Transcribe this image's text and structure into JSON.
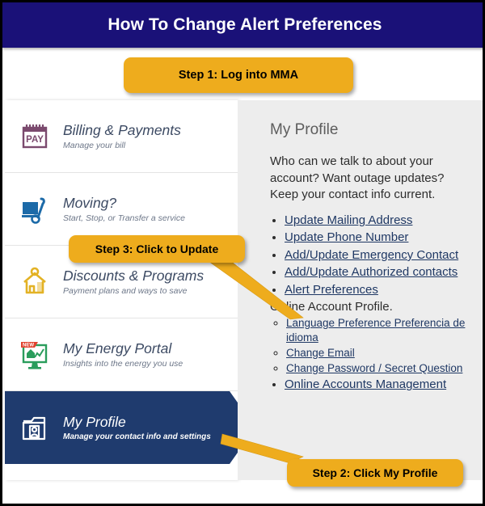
{
  "header": {
    "title": "How To Change Alert Preferences",
    "bg_color": "#1a1178",
    "text_color": "#ffffff"
  },
  "callouts": {
    "accent_color": "#eeac1d",
    "step1": "Step 1:  Log into MMA",
    "step3": "Step 3: Click to Update",
    "step2": "Step 2: Click My Profile"
  },
  "sidebar": {
    "items": [
      {
        "title": "Billing & Payments",
        "subtitle": "Manage your bill",
        "icon": "pay-calendar-icon",
        "icon_color": "#7b4a6e",
        "active": false
      },
      {
        "title": "Moving?",
        "subtitle": "Start, Stop, or Transfer a service",
        "icon": "hand-truck-icon",
        "icon_color": "#1c6aa8",
        "active": false
      },
      {
        "title": "Discounts & Programs",
        "subtitle": "Payment plans and ways to save",
        "icon": "house-icon",
        "icon_color": "#e3b225",
        "active": false
      },
      {
        "title": "My Energy Portal",
        "subtitle": "Insights into the energy you use",
        "icon": "monitor-chart-new-icon",
        "icon_color": "#2a9d5c",
        "badge": "NEW",
        "badge_color": "#e1412c",
        "active": false
      },
      {
        "title": "My Profile",
        "subtitle": "Manage your contact info and settings",
        "icon": "folder-person-icon",
        "icon_color": "#ffffff",
        "active": true,
        "active_color": "#1f3b6e"
      }
    ]
  },
  "panel": {
    "title": "My Profile",
    "intro": "Who can we talk to about your account? Want outage updates? Keep your contact info current.",
    "link_color": "#1f3864",
    "links": [
      {
        "label": "Update Mailing Address",
        "type": "link"
      },
      {
        "label": "Update Phone Number",
        "type": "link"
      },
      {
        "label": "Add/Update Emergency Contact",
        "type": "link"
      },
      {
        "label": "Add/Update Authorized contacts",
        "type": "link"
      },
      {
        "label": "Alert Preferences",
        "type": "link"
      },
      {
        "label": "Online Account Profile.",
        "type": "text",
        "children": [
          {
            "label": "Language Preference Preferencia de idioma",
            "type": "link"
          },
          {
            "label": "Change Email",
            "type": "link"
          },
          {
            "label": "Change Password / Secret Question",
            "type": "link"
          }
        ]
      },
      {
        "label": "Online Accounts Management",
        "type": "link"
      }
    ]
  }
}
